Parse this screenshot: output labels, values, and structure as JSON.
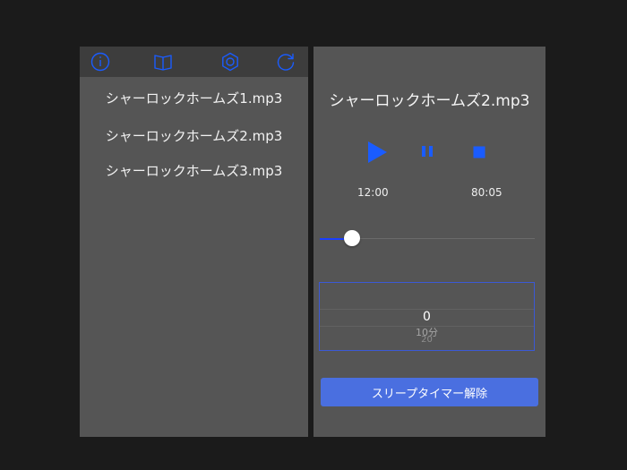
{
  "colors": {
    "background": "#1b1b1b",
    "panel": "#555555",
    "toolbar": "#3d3d3d",
    "accent": "#1a5cff",
    "button": "#4a6fe0"
  },
  "toolbar": {
    "icons": [
      "info-icon",
      "book-icon",
      "settings-icon",
      "refresh-icon"
    ]
  },
  "playlist": {
    "tracks": [
      "シャーロックホームズ1.mp3",
      "シャーロックホームズ2.mp3",
      "シャーロックホームズ3.mp3"
    ]
  },
  "player": {
    "title": "シャーロックホームズ2.mp3",
    "elapsed": "12:00",
    "total": "80:05",
    "progress": 0.15
  },
  "sleep_timer": {
    "selected": "0",
    "next": "10分",
    "next2": "20",
    "button_label": "スリープタイマー解除"
  }
}
